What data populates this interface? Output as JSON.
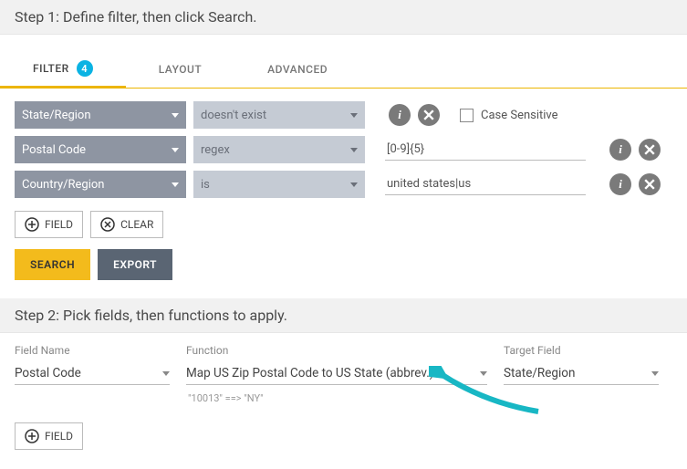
{
  "step1": {
    "title": "Step 1: Define filter, then click Search.",
    "tabs": {
      "filter": "FILTER",
      "layout": "LAYOUT",
      "advanced": "ADVANCED",
      "badge": "4"
    },
    "rows": [
      {
        "field": "State/Region",
        "op": "doesn't exist",
        "value": "",
        "caseSensitive": {
          "label": "Case Sensitive"
        }
      },
      {
        "field": "Postal Code",
        "op": "regex",
        "value": "[0-9]{5}"
      },
      {
        "field": "Country/Region",
        "op": "is",
        "value": "united states|us"
      }
    ],
    "buttons": {
      "addField": "FIELD",
      "clear": "CLEAR",
      "search": "SEARCH",
      "export": "EXPORT"
    }
  },
  "step2": {
    "title": "Step 2: Pick fields, then functions to apply.",
    "headers": {
      "field": "Field Name",
      "function": "Function",
      "target": "Target Field"
    },
    "row": {
      "field": "Postal Code",
      "function": "Map US Zip Postal Code to US State (abbrev.)",
      "target": "State/Region"
    },
    "example": "\"10013\" ==> \"NY\"",
    "addField": "FIELD"
  }
}
